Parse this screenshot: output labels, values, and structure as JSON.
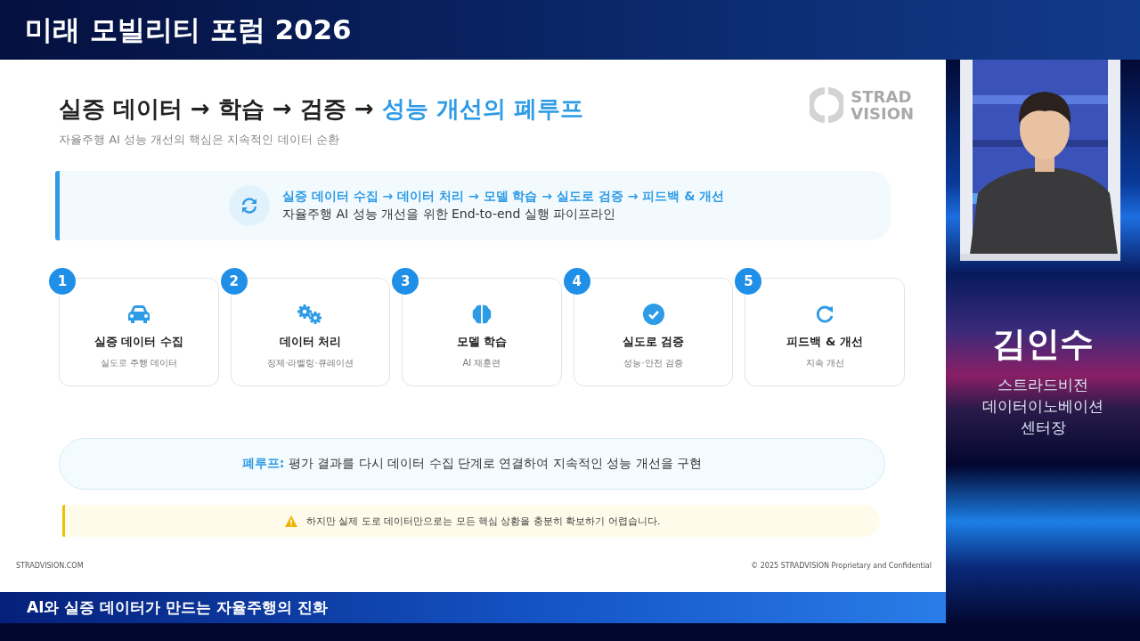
{
  "broadcast_title": "미래 모빌리티 포럼 2026",
  "slide": {
    "title": {
      "plain": "실증 데이터 → 학습 → 검증 →",
      "highlight": "성능 개선의 폐루프"
    },
    "subtitle": "자율주행 AI 성능 개선의 핵심은 지속적인 데이터 순환",
    "logo": {
      "line1": "STRAD",
      "line2": "VISION"
    },
    "pipeline": {
      "steps_text": "실증 데이터 수집 → 데이터 처리 → 모델 학습 → 실도로 검증 → 피드백 & 개선",
      "description": "자율주행 AI 성능 개선을 위한 End-to-end 실행 파이프라인"
    },
    "steps": [
      {
        "number": "1",
        "kind": "car",
        "title": "실증 데이터 수집",
        "caption": "실도로 주행 데이터"
      },
      {
        "number": "2",
        "kind": "gears",
        "title": "데이터 처리",
        "caption": "정제·라벨링·큐레이션"
      },
      {
        "number": "3",
        "kind": "brain",
        "title": "모델 학습",
        "caption": "AI 재훈련"
      },
      {
        "number": "4",
        "kind": "check",
        "title": "실도로 검증",
        "caption": "성능·안전 검증"
      },
      {
        "number": "5",
        "kind": "redo",
        "title": "피드백 & 개선",
        "caption": "지속 개선"
      }
    ],
    "loop_note": {
      "label": "폐루프:",
      "text": "평가 결과를 다시 데이터 수집 단계로 연결하여 지속적인 성능 개선을 구현"
    },
    "warning": "하지만 실제 도로 데이터만으로는 모든 핵심 상황을 충분히 확보하기 어렵습니다.",
    "footer_left": "STRADVISION.COM",
    "footer_right": "© 2025 STRADVISION Proprietary and Confidential"
  },
  "speaker": {
    "name": "김인수",
    "affiliation": [
      "스트라드비전",
      "데이터이노베이션",
      "센터장"
    ]
  },
  "caption": "AI와 실증 데이터가 만드는 자율주행의 진화"
}
